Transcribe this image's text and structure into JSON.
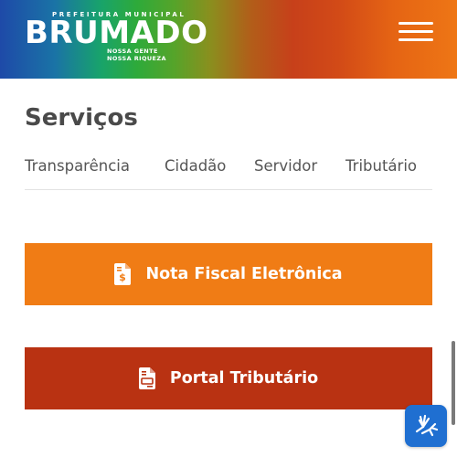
{
  "header": {
    "logo": {
      "top_text": "PREFEITURA MUNICIPAL",
      "name": "BRUMADO",
      "tagline_line1": "NOSSA GENTE",
      "tagline_line2": "NOSSA RIQUEZA"
    },
    "menu_icon": "hamburger-menu-icon"
  },
  "section": {
    "title": "Serviços",
    "tabs": [
      {
        "label": "Transparência"
      },
      {
        "label": "Cidadão"
      },
      {
        "label": "Servidor"
      },
      {
        "label": "Tributário"
      }
    ]
  },
  "services": [
    {
      "label": "Nota Fiscal Eletrônica",
      "icon": "invoice-dollar-icon",
      "color": "#f07c15"
    },
    {
      "label": "Portal Tributário",
      "icon": "document-icon",
      "color": "#b93212"
    }
  ],
  "accessibility": {
    "icon": "sign-language-icon",
    "color": "#1f6fd1"
  }
}
